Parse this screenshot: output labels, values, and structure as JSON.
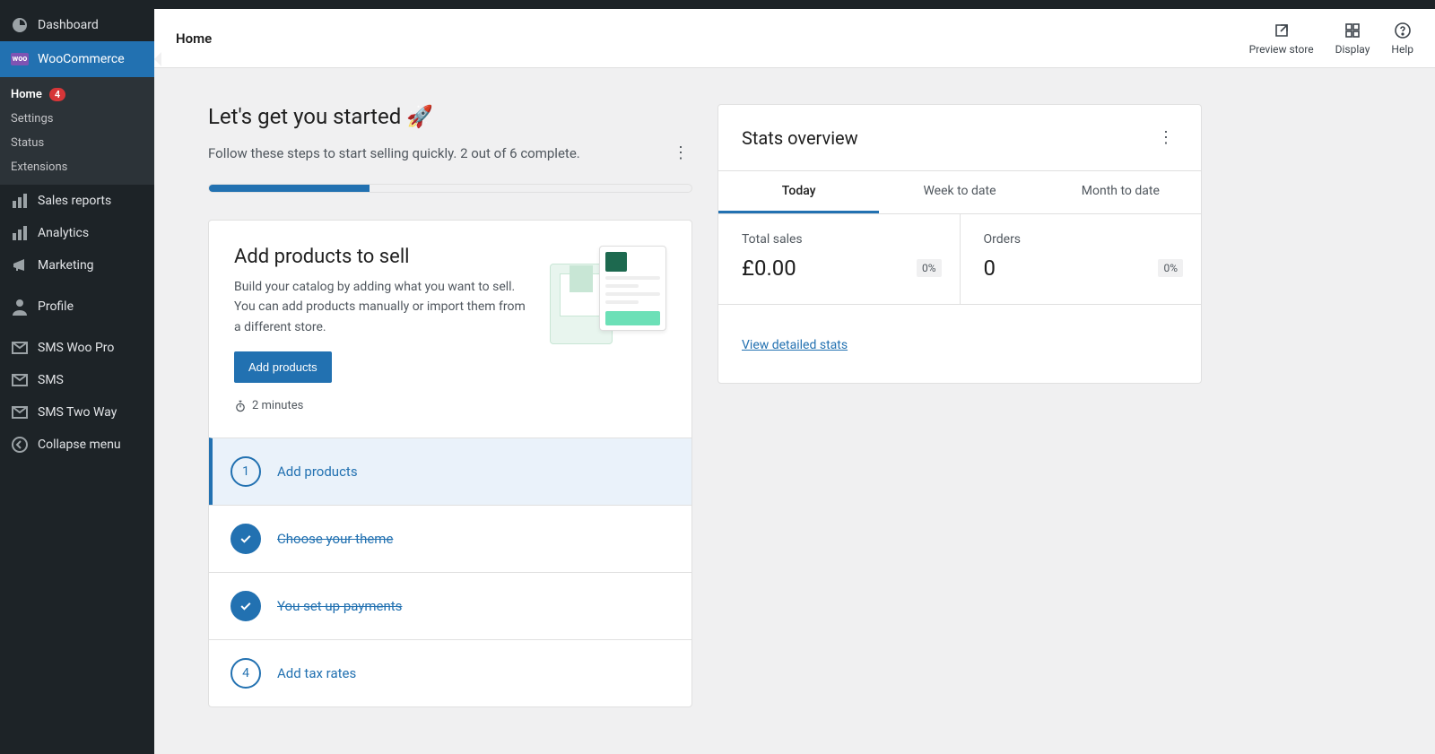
{
  "sidebar": {
    "dashboard": "Dashboard",
    "woocommerce": "WooCommerce",
    "submenu": {
      "home": "Home",
      "home_badge": "4",
      "settings": "Settings",
      "status": "Status",
      "extensions": "Extensions"
    },
    "items": {
      "sales_reports": "Sales reports",
      "analytics": "Analytics",
      "marketing": "Marketing",
      "profile": "Profile",
      "sms_woo_pro": "SMS Woo Pro",
      "sms": "SMS",
      "sms_two_way": "SMS Two Way",
      "collapse": "Collapse menu"
    },
    "woo_badge_text": "woo"
  },
  "topbar": {
    "title": "Home",
    "preview": "Preview store",
    "display": "Display",
    "help": "Help"
  },
  "onboard": {
    "title": "Let's get you started ",
    "rocket": "🚀",
    "subtitle": "Follow these steps to start selling quickly. 2 out of 6 complete.",
    "progress_pct": 33.3,
    "hero": {
      "title": "Add products to sell",
      "body": "Build your catalog by adding what you want to sell. You can add products manually or import them from a different store.",
      "button": "Add products",
      "time": "2 minutes"
    },
    "steps": [
      {
        "num": "1",
        "label": "Add products",
        "done": false,
        "active": true
      },
      {
        "num": "✓",
        "label": "Choose your theme",
        "done": true,
        "active": false
      },
      {
        "num": "✓",
        "label": "You set up payments",
        "done": true,
        "active": false
      },
      {
        "num": "4",
        "label": "Add tax rates",
        "done": false,
        "active": false
      }
    ]
  },
  "stats": {
    "title": "Stats overview",
    "tabs": {
      "today": "Today",
      "week": "Week to date",
      "month": "Month to date"
    },
    "cells": {
      "total_sales_label": "Total sales",
      "total_sales_value": "£0.00",
      "total_sales_pct": "0%",
      "orders_label": "Orders",
      "orders_value": "0",
      "orders_pct": "0%"
    },
    "link": "View detailed stats"
  }
}
